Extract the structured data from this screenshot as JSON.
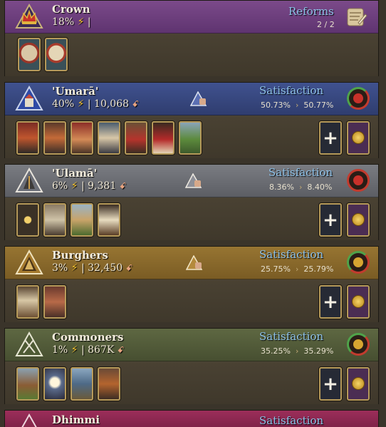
{
  "crown": {
    "name": "Crown",
    "power": "18%",
    "bolt": "⚡",
    "separator": "|",
    "reforms_label": "Reforms",
    "reforms_count": "2 / 2"
  },
  "estates": [
    {
      "name": "'Umarā'",
      "power": "40%",
      "population": "10,068",
      "satisfaction_label": "Satisfaction",
      "sat_current": "50.73%",
      "sat_target": "50.77%",
      "arrow": "›"
    },
    {
      "name": "'Ulamā'",
      "power": "6%",
      "population": "9,381",
      "satisfaction_label": "Satisfaction",
      "sat_current": "8.36%",
      "sat_target": "8.40%",
      "arrow": "›"
    },
    {
      "name": "Burghers",
      "power": "3%",
      "population": "32,450",
      "satisfaction_label": "Satisfaction",
      "sat_current": "25.75%",
      "sat_target": "25.79%",
      "arrow": "›"
    },
    {
      "name": "Commoners",
      "power": "1%",
      "population": "867K",
      "satisfaction_label": "Satisfaction",
      "sat_current": "35.25%",
      "sat_target": "35.29%",
      "arrow": "›"
    },
    {
      "name": "Dhimmi",
      "satisfaction_label": "Satisfaction"
    }
  ],
  "symbols": {
    "bolt": "⚡",
    "pop": "ꗃ",
    "plus": "+",
    "sep": "|"
  },
  "colors": {
    "crown_header": "#6e3f7d",
    "umara_header": "#37467e",
    "ulama_header": "#6a6c72",
    "burghers_header": "#8a6a2c",
    "commoners_header": "#525a37",
    "dhimmi_header": "#8e2a52",
    "satisfaction_text": "#8fc3ea"
  },
  "icons": {
    "crown_emblem": "crown-icon",
    "reforms": "scroll-icon",
    "estate_emblem": "triangle-estate-icon",
    "privilege": "privilege-card-icon",
    "add": "plus-icon",
    "gold": "gold-coins-icon",
    "satisfaction": "satisfaction-ring-icon",
    "hand": "hand-triangle-icon"
  }
}
